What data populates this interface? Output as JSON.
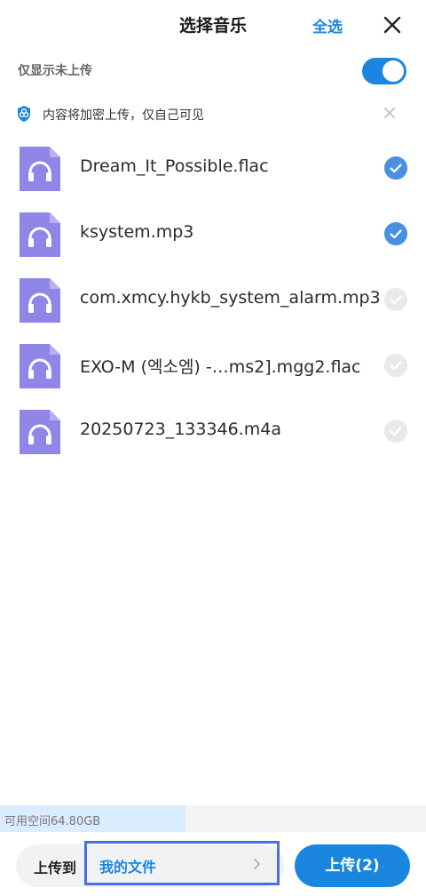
{
  "header": {
    "title": "选择音乐",
    "select_all_label": "全选"
  },
  "filter": {
    "only_not_uploaded_label": "仅显示未上传",
    "toggle_on": true
  },
  "notice": {
    "text": "内容将加密上传，仅自己可见"
  },
  "files": [
    {
      "name": "Dream_It_Possible.flac",
      "selected": true
    },
    {
      "name": "ksystem.mp3",
      "selected": true
    },
    {
      "name": "com.xmcy.hykb_system_alarm.mp3",
      "selected": false
    },
    {
      "name": "EXO-M (엑소엠) -…ms2].mgg2.flac",
      "selected": false
    },
    {
      "name": "20250723_133346.m4a",
      "selected": false
    }
  ],
  "storage": {
    "text": "可用空间64.80GB",
    "used_fraction": 0.435
  },
  "footer": {
    "upload_to_label": "上传到",
    "destination": "我的文件",
    "upload_button": "上传(2)"
  },
  "colors": {
    "accent": "#1b86e0",
    "file_icon": "#8f86e8",
    "check_on": "#4a90e2",
    "check_off": "#e9e9ec"
  },
  "icons": {
    "close": "close-icon",
    "shield": "shield-icon",
    "file": "headphones-file-icon",
    "check": "check-icon",
    "chevron": "chevron-right-icon"
  }
}
